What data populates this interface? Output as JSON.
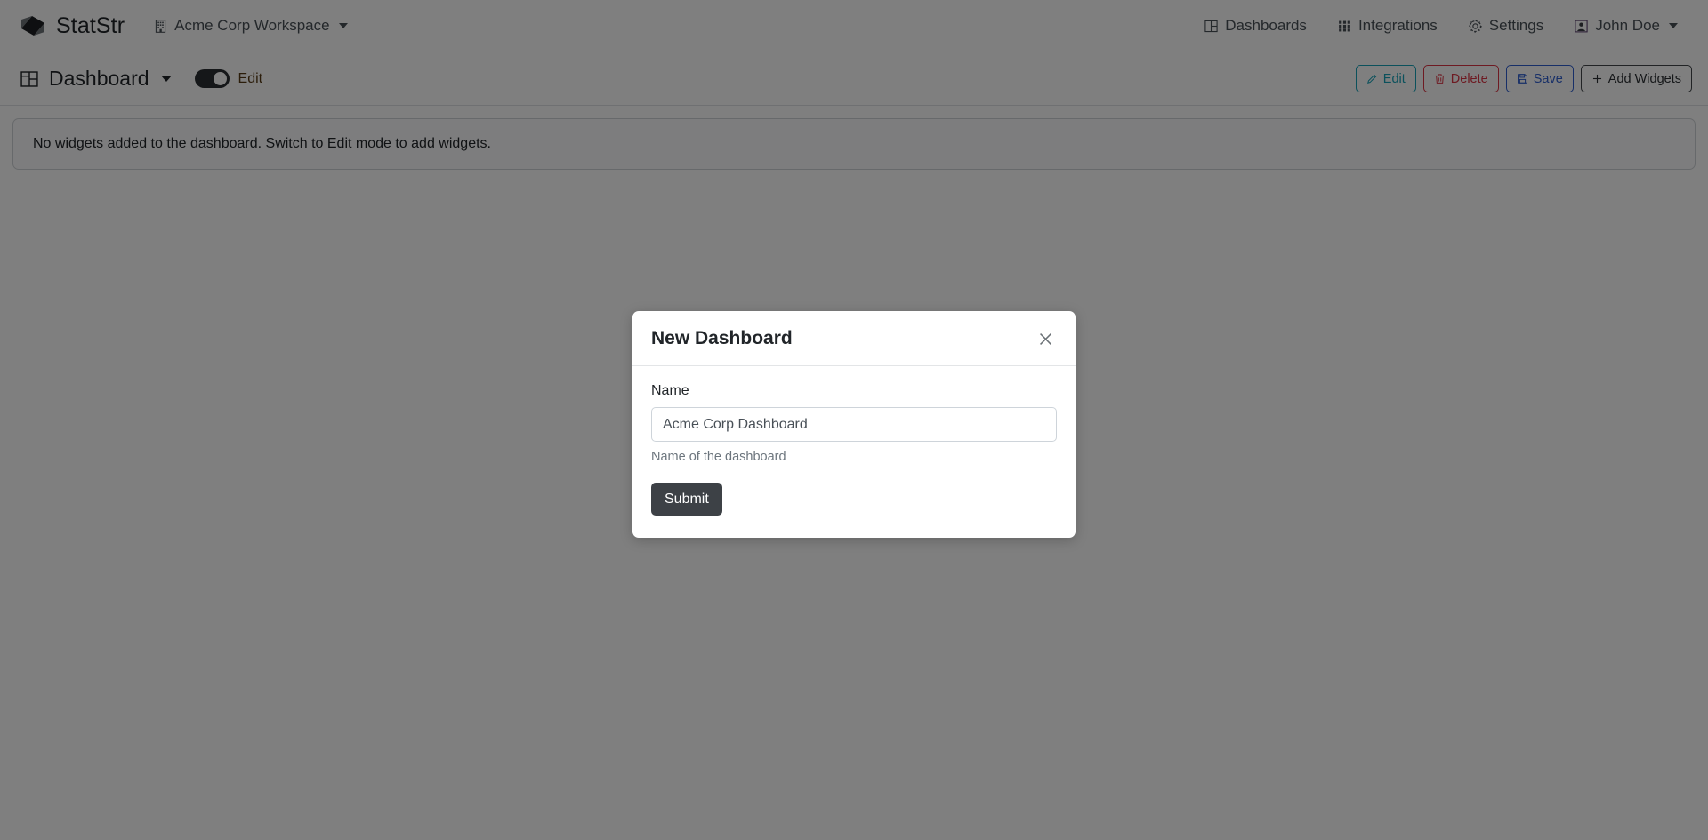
{
  "navbar": {
    "brand_name": "StatStr",
    "brand_icon": "statstr-logo-icon",
    "workspace": {
      "label": "Acme Corp Workspace",
      "icon": "building-icon",
      "has_caret": true
    },
    "right_items": [
      {
        "label": "Dashboards",
        "icon": "dashboard-grid-icon",
        "has_caret": false
      },
      {
        "label": "Integrations",
        "icon": "apps-grid-icon",
        "has_caret": false
      },
      {
        "label": "Settings",
        "icon": "gear-icon",
        "has_caret": false
      },
      {
        "label": "John Doe",
        "icon": "user-icon",
        "has_caret": true
      }
    ]
  },
  "toolbar": {
    "title": "Dashboard",
    "title_icon": "dashboard-layout-icon",
    "edit_toggle": {
      "label": "Edit",
      "state": "on"
    },
    "buttons": [
      {
        "label": "Edit",
        "icon": "pencil-icon",
        "color": "#17a2b8"
      },
      {
        "label": "Delete",
        "icon": "trash-icon",
        "color": "#dc3545"
      },
      {
        "label": "Save",
        "icon": "floppy-disk-icon",
        "color": "#2f5fd0"
      },
      {
        "label": "Add Widgets",
        "icon": "plus-icon",
        "color": "#2b2f33"
      }
    ]
  },
  "content": {
    "empty_alert": "No widgets added to the dashboard. Switch to Edit mode to add widgets."
  },
  "modal": {
    "title": "New Dashboard",
    "close_icon": "close-icon",
    "field_label": "Name",
    "field_value": "Acme Corp Dashboard",
    "field_placeholder": "",
    "field_help": "Name of the dashboard",
    "submit_label": "Submit"
  },
  "colors": {
    "accent_edit": "#17a2b8",
    "accent_delete": "#dc3545",
    "accent_save": "#2f5fd0",
    "submit_bg": "#3d4146",
    "backdrop": "rgba(0,0,0,0.5)"
  }
}
